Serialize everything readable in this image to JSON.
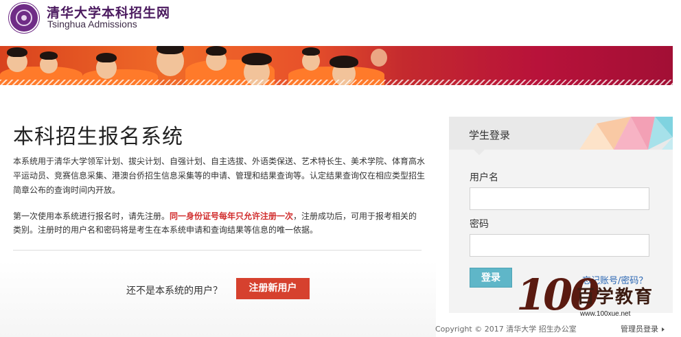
{
  "header": {
    "title": "清华大学本科招生网",
    "subtitle": "Tsinghua Admissions"
  },
  "main": {
    "title": "本科招生报名系统",
    "description": "本系统用于清华大学领军计划、拔尖计划、自强计划、自主选拔、外语类保送、艺术特长生、美术学院、体育高水平运动员、竞赛信息采集、港澳台侨招生信息采集等的申请、管理和结果查询等。认定结果查询仅在相应类型招生简章公布的查询时间内开放。",
    "first_use_prefix": "第一次使用本系统进行报名时，请先注册。",
    "first_use_emphasis": "同一身份证号每年只允许注册一次",
    "first_use_suffix": "，注册成功后，可用于报考相关的类别。注册时的用户名和密码将是考生在本系统申请和查询结果等信息的唯一依据。",
    "not_user_label": "还不是本系统的用户？",
    "register_label": "注册新用户"
  },
  "login": {
    "heading": "学生登录",
    "username_label": "用户名",
    "username_value": "",
    "password_label": "密码",
    "password_value": "",
    "submit_label": "登录",
    "forgot_label": "忘记账号/密码？"
  },
  "watermark": {
    "number": "100",
    "text": "百学教育",
    "url": "www.100xue.net"
  },
  "footer": {
    "copyright": "Copyright © 2017 清华大学 招生办公室",
    "admin_label": "管理员登录"
  },
  "colors": {
    "brand": "#6f2c86",
    "register": "#d6412e",
    "login": "#5fb6c8",
    "emphasis": "#d12d2d"
  }
}
